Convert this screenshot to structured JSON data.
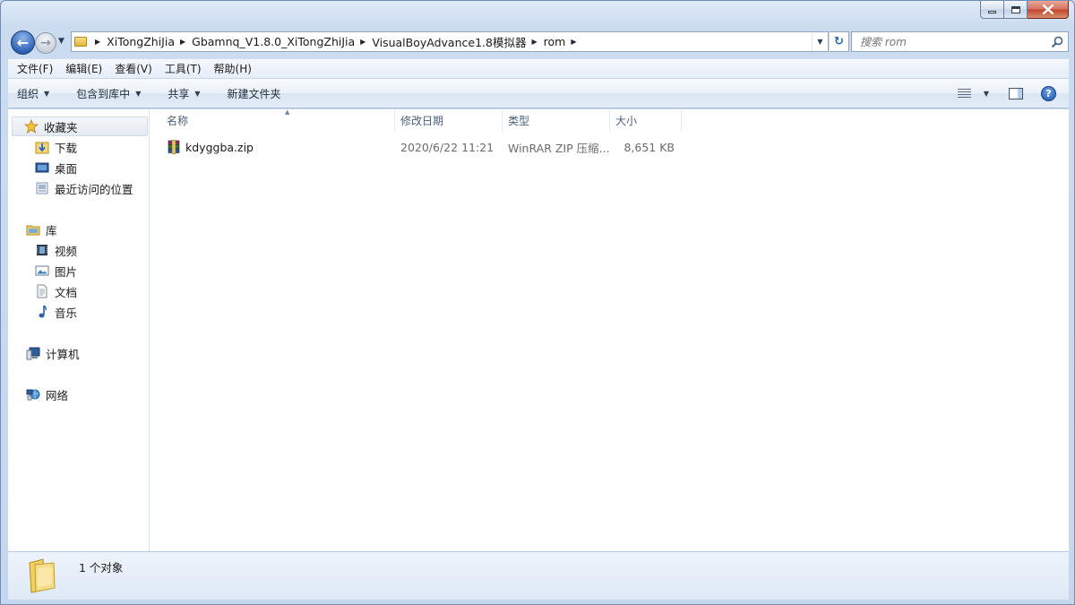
{
  "window": {
    "caption_buttons": [
      "minimize-icon",
      "maximize-icon",
      "close-icon"
    ]
  },
  "nav": {
    "back_icon": "arrow-left-icon",
    "forward_icon": "arrow-right-icon",
    "history_icon": "chevron-down-icon"
  },
  "address": {
    "breadcrumbs": [
      "XiTongZhiJia",
      "Gbamnq_V1.8.0_XiTongZhiJia",
      "VisualBoyAdvance1.8模拟器",
      "rom"
    ]
  },
  "search": {
    "placeholder": "搜索 rom",
    "icon": "search-icon"
  },
  "menu": {
    "items": [
      "文件(F)",
      "编辑(E)",
      "查看(V)",
      "工具(T)",
      "帮助(H)"
    ]
  },
  "toolbar": {
    "organize": "组织",
    "include_library": "包含到库中",
    "share": "共享",
    "new_folder": "新建文件夹"
  },
  "sidebar": {
    "favorites": {
      "label": "收藏夹",
      "items": [
        "下载",
        "桌面",
        "最近访问的位置"
      ]
    },
    "libraries": {
      "label": "库",
      "items": [
        "视频",
        "图片",
        "文档",
        "音乐"
      ]
    },
    "computer": "计算机",
    "network": "网络"
  },
  "columns": {
    "name": "名称",
    "modified": "修改日期",
    "type": "类型",
    "size": "大小"
  },
  "files": [
    {
      "name": "kdyggba.zip",
      "modified": "2020/6/22 11:21",
      "type": "WinRAR ZIP 压缩...",
      "size": "8,651 KB",
      "icon": "winrar-archive-icon"
    }
  ],
  "status": {
    "count_text": "1 个对象"
  },
  "colors": {
    "frame": "#c5d7ec",
    "accent": "#2f63b5"
  }
}
